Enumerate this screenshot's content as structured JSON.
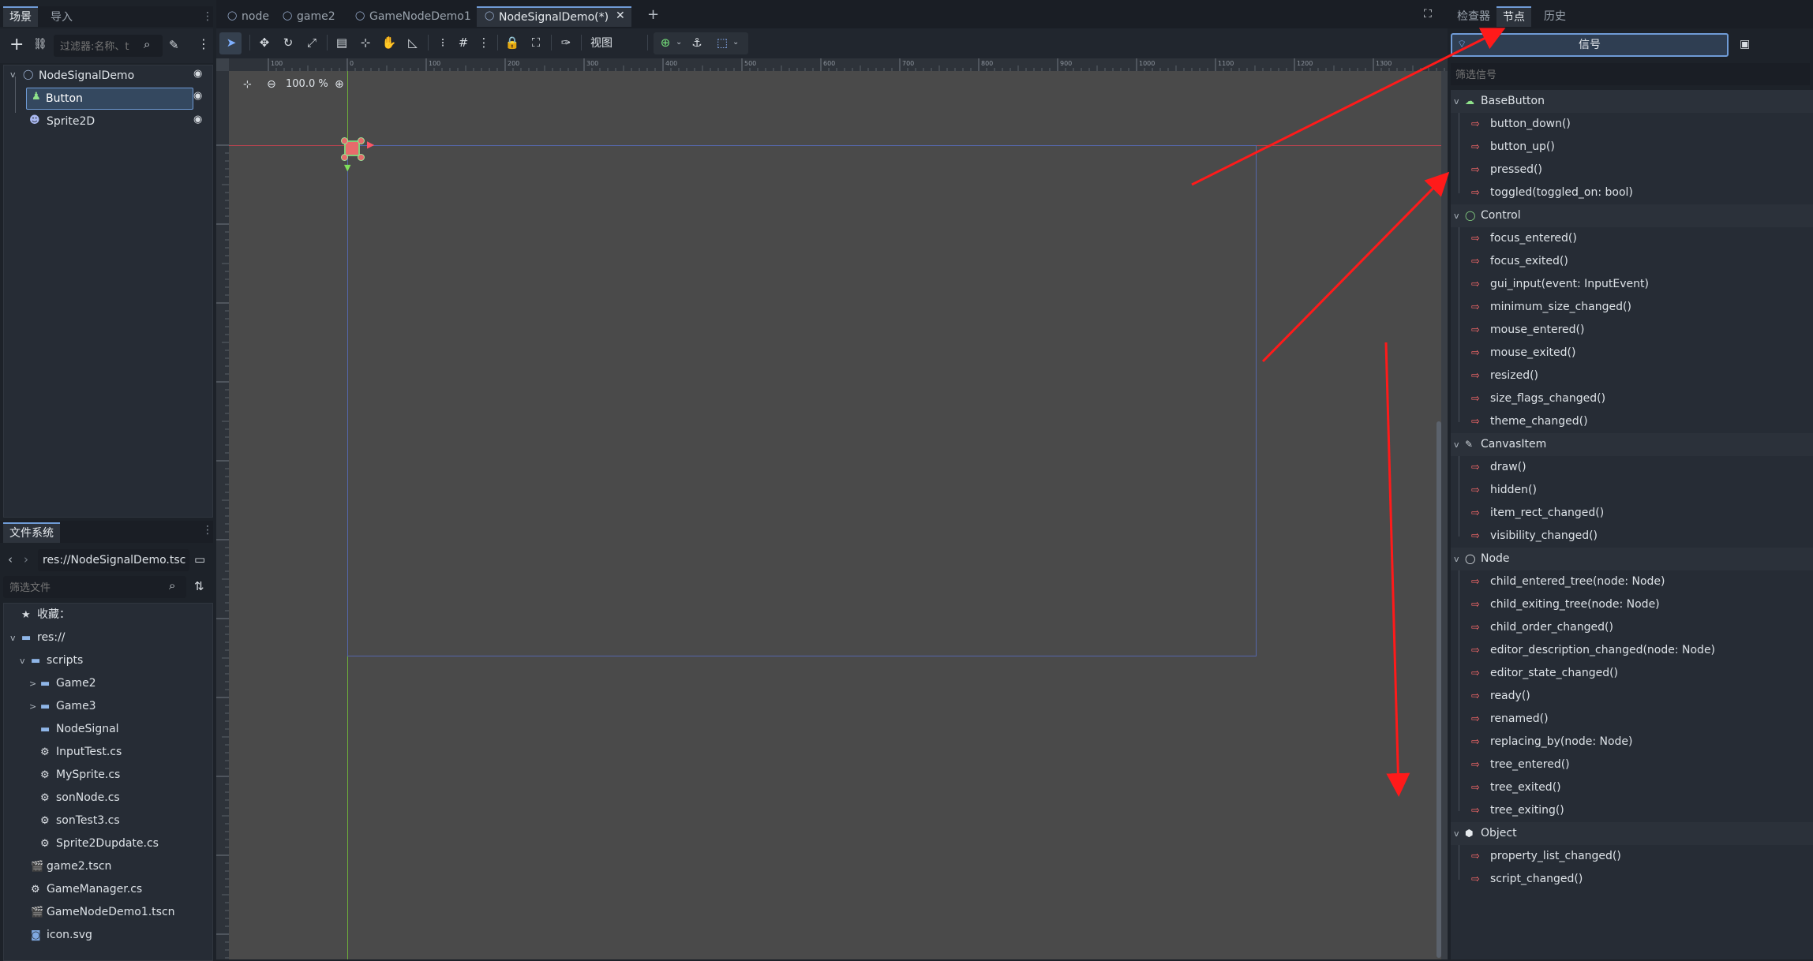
{
  "scene_dock": {
    "tabs": [
      "场景",
      "导入"
    ],
    "filter_placeholder": "过滤器:名称、t",
    "tree": [
      {
        "label": "NodeSignalDemo",
        "icon": "node-circle-icon"
      },
      {
        "label": "Button",
        "icon": "button-node-icon"
      },
      {
        "label": "Sprite2D",
        "icon": "sprite2d-icon"
      }
    ]
  },
  "filesystem": {
    "tab": "文件系统",
    "path": "res://NodeSignalDemo.tsc",
    "filter_placeholder": "筛选文件",
    "favorites": "收藏：",
    "items": [
      {
        "label": "res://",
        "type": "folder",
        "indent": 0,
        "caret": "v"
      },
      {
        "label": "scripts",
        "type": "folder",
        "indent": 1,
        "caret": "v"
      },
      {
        "label": "Game2",
        "type": "folder",
        "indent": 2,
        "caret": ">"
      },
      {
        "label": "Game3",
        "type": "folder",
        "indent": 2,
        "caret": ">"
      },
      {
        "label": "NodeSignal",
        "type": "folder",
        "indent": 2,
        "caret": ""
      },
      {
        "label": "InputTest.cs",
        "type": "script",
        "indent": 2,
        "caret": ""
      },
      {
        "label": "MySprite.cs",
        "type": "script",
        "indent": 2,
        "caret": ""
      },
      {
        "label": "sonNode.cs",
        "type": "script",
        "indent": 2,
        "caret": ""
      },
      {
        "label": "sonTest3.cs",
        "type": "script",
        "indent": 2,
        "caret": ""
      },
      {
        "label": "Sprite2Dupdate.cs",
        "type": "script",
        "indent": 2,
        "caret": ""
      },
      {
        "label": "game2.tscn",
        "type": "scene",
        "indent": 1,
        "caret": ""
      },
      {
        "label": "GameManager.cs",
        "type": "script",
        "indent": 1,
        "caret": ""
      },
      {
        "label": "GameNodeDemo1.tscn",
        "type": "scene",
        "indent": 1,
        "caret": ""
      },
      {
        "label": "icon.svg",
        "type": "image",
        "indent": 1,
        "caret": ""
      }
    ]
  },
  "editor": {
    "tabs": [
      "node",
      "game2",
      "GameNodeDemo1",
      "NodeSignalDemo(*)"
    ],
    "active_tab": 3,
    "view_menu": "视图",
    "zoom": "100.0 %",
    "ruler_labels": [
      "100",
      "0",
      "100",
      "200",
      "300",
      "400",
      "500",
      "600",
      "700",
      "800",
      "900",
      "1000",
      "1100",
      "1200",
      "1300"
    ]
  },
  "right_dock": {
    "tabs": [
      "检查器",
      "节点",
      "历史"
    ],
    "active_tab": 1,
    "signals_button": "信号",
    "filter_placeholder": "筛选信号",
    "groups": [
      {
        "name": "BaseButton",
        "icon": "basebutton-icon",
        "signals": [
          "button_down()",
          "button_up()",
          "pressed()",
          "toggled(toggled_on: bool)"
        ]
      },
      {
        "name": "Control",
        "icon": "control-icon",
        "signals": [
          "focus_entered()",
          "focus_exited()",
          "gui_input(event: InputEvent)",
          "minimum_size_changed()",
          "mouse_entered()",
          "mouse_exited()",
          "resized()",
          "size_flags_changed()",
          "theme_changed()"
        ]
      },
      {
        "name": "CanvasItem",
        "icon": "canvasitem-icon",
        "signals": [
          "draw()",
          "hidden()",
          "item_rect_changed()",
          "visibility_changed()"
        ]
      },
      {
        "name": "Node",
        "icon": "node-icon",
        "signals": [
          "child_entered_tree(node: Node)",
          "child_exiting_tree(node: Node)",
          "child_order_changed()",
          "editor_description_changed(node: Node)",
          "editor_state_changed()",
          "ready()",
          "renamed()",
          "replacing_by(node: Node)",
          "tree_entered()",
          "tree_exited()",
          "tree_exiting()"
        ]
      },
      {
        "name": "Object",
        "icon": "object-icon",
        "signals": [
          "property_list_changed()",
          "script_changed()"
        ]
      }
    ]
  },
  "colors": {
    "accent": "#6f9bd6",
    "signal": "#ff6b6b",
    "annotation_arrow": "#ff1a1a",
    "viewport_bg": "#4a4a4a"
  }
}
